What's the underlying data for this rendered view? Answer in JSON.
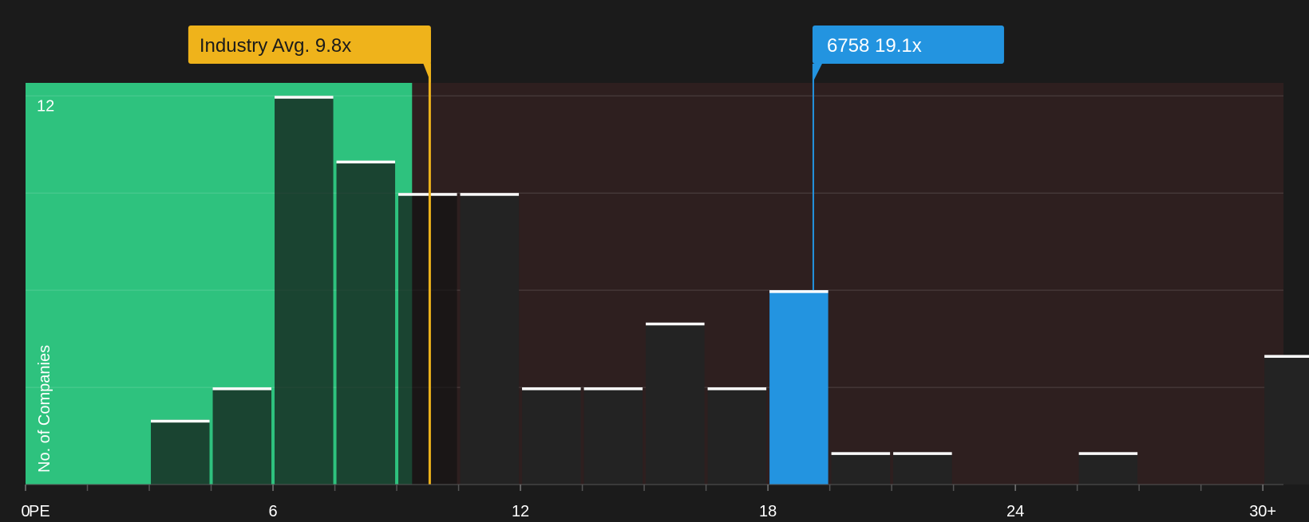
{
  "colors": {
    "background": "#1b1b1b",
    "below_avg_zone": "#2ec27e",
    "above_avg_zone": "#2e1f1f",
    "bar_fill": "#232323",
    "bar_cap": "#ffffff",
    "highlight": "#2394e0",
    "industry_avg": "#efb31b",
    "gridline": "#4a4040",
    "axis_text": "#ffffff"
  },
  "chart_data": {
    "type": "bar",
    "xlabel": "PE",
    "ylabel": "No. of Companies",
    "xlim": [
      0,
      30.5
    ],
    "ylim": [
      0,
      12.4
    ],
    "bin_width": 1.5,
    "x_ticks": [
      {
        "value": 0,
        "label": "0"
      },
      {
        "value": 6,
        "label": "6"
      },
      {
        "value": 12,
        "label": "12"
      },
      {
        "value": 18,
        "label": "18"
      },
      {
        "value": 24,
        "label": "24"
      },
      {
        "value": 30,
        "label": "30+"
      }
    ],
    "minor_ticks": [
      1.5,
      3,
      4.5,
      7.5,
      9,
      10.5,
      13.5,
      15,
      16.5,
      19.5,
      21,
      22.5,
      25.5,
      27,
      28.5
    ],
    "y_gridlines": [
      3,
      6,
      9,
      12
    ],
    "y_tick_labels": [
      {
        "value": 12,
        "label": "12"
      }
    ],
    "bins": [
      {
        "start": 3.0,
        "count": 2
      },
      {
        "start": 4.5,
        "count": 3
      },
      {
        "start": 6.0,
        "count": 12
      },
      {
        "start": 7.5,
        "count": 10
      },
      {
        "start": 9.0,
        "count": 9
      },
      {
        "start": 10.5,
        "count": 9
      },
      {
        "start": 12.0,
        "count": 3
      },
      {
        "start": 13.5,
        "count": 3
      },
      {
        "start": 15.0,
        "count": 5
      },
      {
        "start": 16.5,
        "count": 3
      },
      {
        "start": 18.0,
        "count": 6,
        "highlight": true
      },
      {
        "start": 19.5,
        "count": 1
      },
      {
        "start": 21.0,
        "count": 1
      },
      {
        "start": 25.5,
        "count": 1
      },
      {
        "start": 30.0,
        "count": 4
      }
    ],
    "industry_avg": {
      "value": 9.8,
      "label": "Industry Avg. 9.8x"
    },
    "company": {
      "value": 19.1,
      "label": "6758 19.1x"
    }
  }
}
